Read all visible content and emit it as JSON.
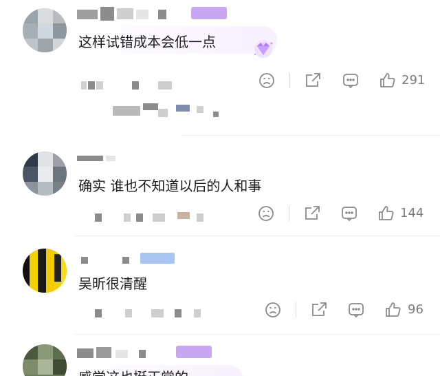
{
  "comments": [
    {
      "text": "这样试错成本会低一点",
      "likes": "291",
      "badge_icon": "gem-badge-icon"
    },
    {
      "text": "确实 谁也不知道以后的人和事",
      "likes": "144"
    },
    {
      "text": "吴昕很清醒",
      "likes": "96"
    },
    {
      "text": "感觉这也挺正常的"
    }
  ],
  "icons": {
    "dislike": "sad-face-icon",
    "share": "share-icon",
    "reply": "comment-icon",
    "like": "thumbs-up-icon"
  },
  "colors": {
    "accent_purple": "#b07cf5",
    "icon_gray": "#8a8a8a"
  }
}
